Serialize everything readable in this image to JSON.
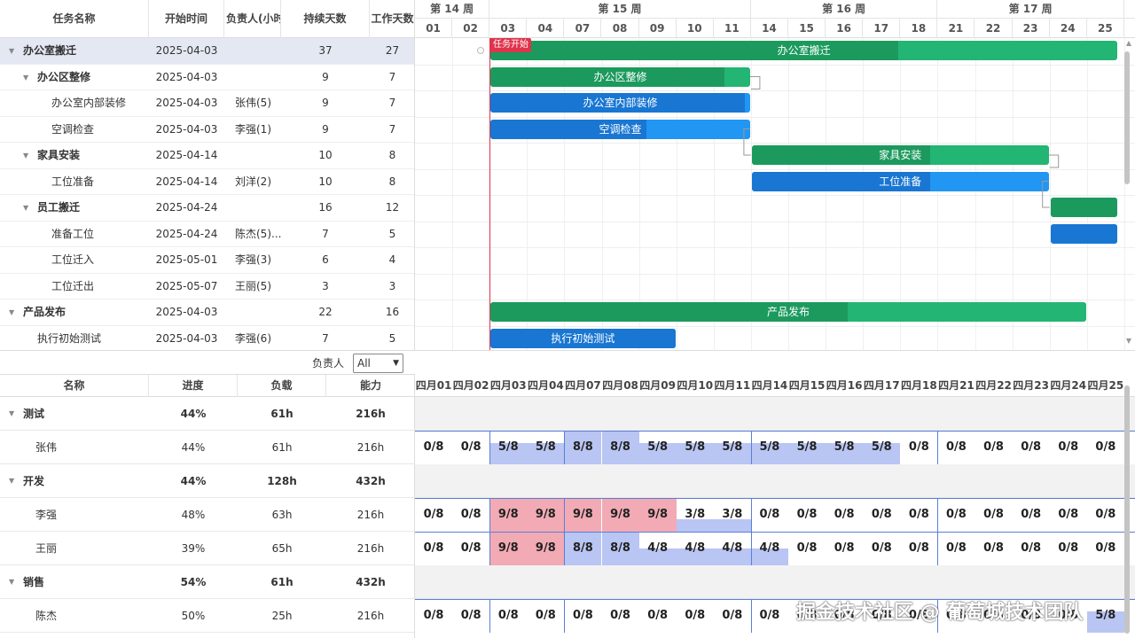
{
  "task_grid": {
    "headers": [
      "任务名称",
      "开始时间",
      "负责人(小时",
      "持续天数",
      "工作天数"
    ],
    "rows": [
      {
        "name": "办公室搬迁",
        "start": "2025-04-03",
        "owner": "",
        "duration": "37",
        "workdays": "27",
        "level": 0,
        "group": true,
        "selected": true
      },
      {
        "name": "办公区整修",
        "start": "2025-04-03",
        "owner": "",
        "duration": "9",
        "workdays": "7",
        "level": 1,
        "group": true
      },
      {
        "name": "办公室内部装修",
        "start": "2025-04-03",
        "owner": "张伟(5)",
        "duration": "9",
        "workdays": "7",
        "level": 2,
        "group": false
      },
      {
        "name": "空调检查",
        "start": "2025-04-03",
        "owner": "李强(1)",
        "duration": "9",
        "workdays": "7",
        "level": 2,
        "group": false
      },
      {
        "name": "家具安装",
        "start": "2025-04-14",
        "owner": "",
        "duration": "10",
        "workdays": "8",
        "level": 1,
        "group": true
      },
      {
        "name": "工位准备",
        "start": "2025-04-14",
        "owner": "刘洋(2)",
        "duration": "10",
        "workdays": "8",
        "level": 2,
        "group": false
      },
      {
        "name": "员工搬迁",
        "start": "2025-04-24",
        "owner": "",
        "duration": "16",
        "workdays": "12",
        "level": 1,
        "group": true
      },
      {
        "name": "准备工位",
        "start": "2025-04-24",
        "owner": "陈杰(5)...",
        "duration": "7",
        "workdays": "5",
        "level": 2,
        "group": false
      },
      {
        "name": "工位迁入",
        "start": "2025-05-01",
        "owner": "李强(3)",
        "duration": "6",
        "workdays": "4",
        "level": 2,
        "group": false
      },
      {
        "name": "工位迁出",
        "start": "2025-05-07",
        "owner": "王丽(5)",
        "duration": "3",
        "workdays": "3",
        "level": 2,
        "group": false
      },
      {
        "name": "产品发布",
        "start": "2025-04-03",
        "owner": "",
        "duration": "22",
        "workdays": "16",
        "level": 0,
        "group": true
      },
      {
        "name": "执行初始测试",
        "start": "2025-04-03",
        "owner": "李强(6)",
        "duration": "7",
        "workdays": "5",
        "level": 1,
        "group": false
      }
    ]
  },
  "timeline": {
    "weeks": [
      "第 14 周",
      "第 15 周",
      "第 16 周",
      "第 17 周"
    ],
    "days": [
      "01",
      "02",
      "03",
      "04",
      "07",
      "08",
      "09",
      "10",
      "11",
      "14",
      "15",
      "16",
      "17",
      "18",
      "21",
      "22",
      "23",
      "24",
      "25"
    ],
    "today_label": "任务开始",
    "bars": [
      {
        "label": "办公室搬迁",
        "color": "green",
        "progress": 0.65
      },
      {
        "label": "办公区整修",
        "color": "green",
        "progress": 0.9
      },
      {
        "label": "办公室内部装修",
        "color": "blue",
        "progress": 0.98
      },
      {
        "label": "空调检查",
        "color": "blue",
        "progress": 0.6
      },
      {
        "label": "家具安装",
        "color": "green",
        "progress": 0.6
      },
      {
        "label": "工位准备",
        "color": "blue",
        "progress": 0.6
      },
      {
        "label": "",
        "color": "green",
        "progress": 1.0
      },
      {
        "label": "",
        "color": "blue",
        "progress": 1.0
      },
      {
        "label": "产品发布",
        "color": "green",
        "progress": 0.6
      },
      {
        "label": "执行初始测试",
        "color": "blue",
        "progress": 1.0
      }
    ]
  },
  "filter": {
    "label": "负责人",
    "value": "All"
  },
  "resource_grid": {
    "headers": [
      "名称",
      "进度",
      "负载",
      "能力"
    ],
    "rows": [
      {
        "name": "测试",
        "progress": "44%",
        "load": "61h",
        "capacity": "216h",
        "group": true
      },
      {
        "name": "张伟",
        "progress": "44%",
        "load": "61h",
        "capacity": "216h",
        "group": false
      },
      {
        "name": "开发",
        "progress": "44%",
        "load": "128h",
        "capacity": "432h",
        "group": true
      },
      {
        "name": "李强",
        "progress": "48%",
        "load": "63h",
        "capacity": "216h",
        "group": false
      },
      {
        "name": "王丽",
        "progress": "39%",
        "load": "65h",
        "capacity": "216h",
        "group": false
      },
      {
        "name": "销售",
        "progress": "54%",
        "load": "61h",
        "capacity": "432h",
        "group": true
      },
      {
        "name": "陈杰",
        "progress": "50%",
        "load": "25h",
        "capacity": "216h",
        "group": false
      }
    ]
  },
  "resource_timeline": {
    "days": [
      "四月01",
      "四月02",
      "四月03",
      "四月04",
      "四月07",
      "四月08",
      "四月09",
      "四月10",
      "四月11",
      "四月14",
      "四月15",
      "四月16",
      "四月17",
      "四月18",
      "四月21",
      "四月22",
      "四月23",
      "四月24",
      "四月25"
    ],
    "loads": {
      "张伟": [
        "0/8",
        "0/8",
        "5/8",
        "5/8",
        "8/8",
        "8/8",
        "5/8",
        "5/8",
        "5/8",
        "5/8",
        "5/8",
        "5/8",
        "5/8",
        "0/8",
        "0/8",
        "0/8",
        "0/8",
        "0/8",
        "0/8"
      ],
      "李强": [
        "0/8",
        "0/8",
        "9/8",
        "9/8",
        "9/8",
        "9/8",
        "9/8",
        "3/8",
        "3/8",
        "0/8",
        "0/8",
        "0/8",
        "0/8",
        "0/8",
        "0/8",
        "0/8",
        "0/8",
        "0/8",
        "0/8"
      ],
      "王丽": [
        "0/8",
        "0/8",
        "9/8",
        "9/8",
        "8/8",
        "8/8",
        "4/8",
        "4/8",
        "4/8",
        "4/8",
        "0/8",
        "0/8",
        "0/8",
        "0/8",
        "0/8",
        "0/8",
        "0/8",
        "0/8",
        "0/8"
      ],
      "陈杰": [
        "0/8",
        "0/8",
        "0/8",
        "0/8",
        "0/8",
        "0/8",
        "0/8",
        "0/8",
        "0/8",
        "0/8",
        "0/8",
        "0/8",
        "0/8",
        "0/8",
        "0/8",
        "0/8",
        "0/8",
        "0/8",
        "5/8"
      ]
    },
    "colors": {
      "over": "#f2aab5",
      "normal": "#b9c5f3",
      "full": "#aebcf1"
    }
  },
  "watermark": "掘金技术社区 @ 葡萄城技术团队"
}
